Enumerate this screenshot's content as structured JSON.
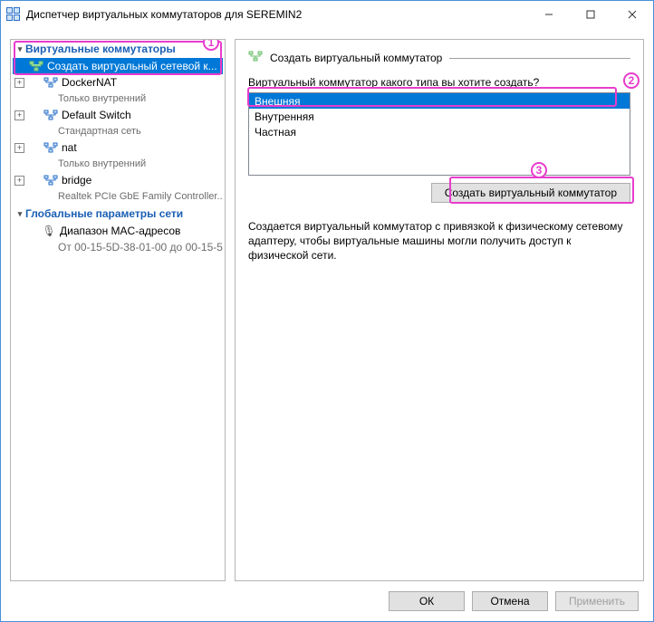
{
  "window": {
    "title": "Диспетчер виртуальных коммутаторов для SEREMIN2"
  },
  "tree": {
    "section1": "Виртуальные коммутаторы",
    "new_switch": "Создать виртуальный сетевой к...",
    "items": [
      {
        "name": "DockerNAT",
        "sub": "Только внутренний"
      },
      {
        "name": "Default Switch",
        "sub": "Стандартная сеть"
      },
      {
        "name": "nat",
        "sub": "Только внутренний"
      },
      {
        "name": "bridge",
        "sub": "Realtek PCIe GbE Family Controller..."
      }
    ],
    "section2": "Глобальные параметры сети",
    "mac": {
      "name": "Диапазон MAC-адресов",
      "sub": "От 00-15-5D-38-01-00 до 00-15-5..."
    }
  },
  "right": {
    "header": "Создать виртуальный коммутатор",
    "prompt": "Виртуальный коммутатор какого типа вы хотите создать?",
    "options": [
      "Внешняя",
      "Внутренняя",
      "Частная"
    ],
    "create_btn": "Создать виртуальный коммутатор",
    "desc": "Создается виртуальный коммутатор с привязкой к физическому сетевому адаптеру, чтобы виртуальные машины могли получить доступ к физической сети."
  },
  "footer": {
    "ok": "ОК",
    "cancel": "Отмена",
    "apply": "Применить"
  },
  "annotations": {
    "n1": "1",
    "n2": "2",
    "n3": "3"
  }
}
